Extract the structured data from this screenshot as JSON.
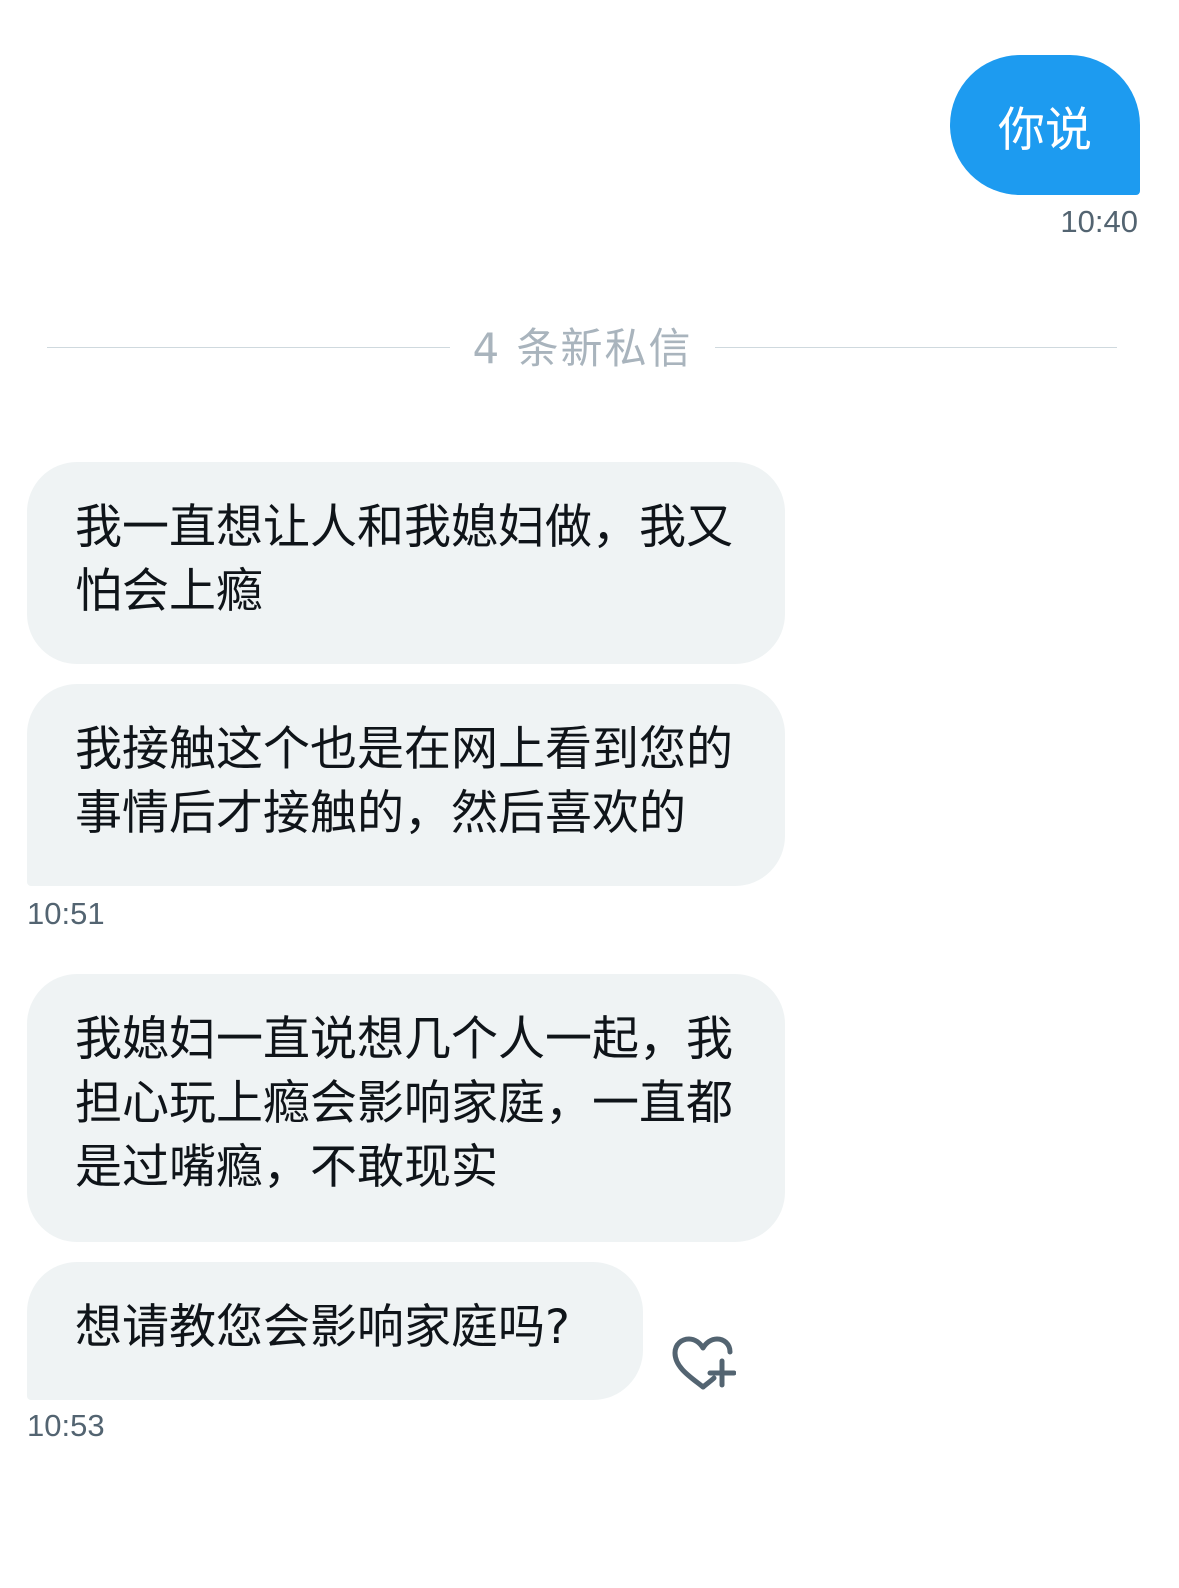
{
  "outgoing": {
    "text": "你说",
    "time": "10:40"
  },
  "divider": {
    "label": "4 条新私信"
  },
  "incoming": [
    {
      "text": "我一直想让人和我媳妇做，我又怕会上瘾"
    },
    {
      "text": "我接触这个也是在网上看到您的事情后才接触的，然后喜欢的"
    },
    {
      "text": "我媳妇一直说想几个人一起，我担心玩上瘾会影响家庭，一直都是过嘴瘾，不敢现实"
    },
    {
      "text": "想请教您会影响家庭吗?"
    }
  ],
  "times": {
    "group1": "10:51",
    "group2": "10:53"
  },
  "icons": {
    "like": "heart-plus-icon"
  },
  "colors": {
    "accent": "#1d9bf0",
    "incoming_bg": "#eff3f4",
    "muted_text": "#536471"
  }
}
